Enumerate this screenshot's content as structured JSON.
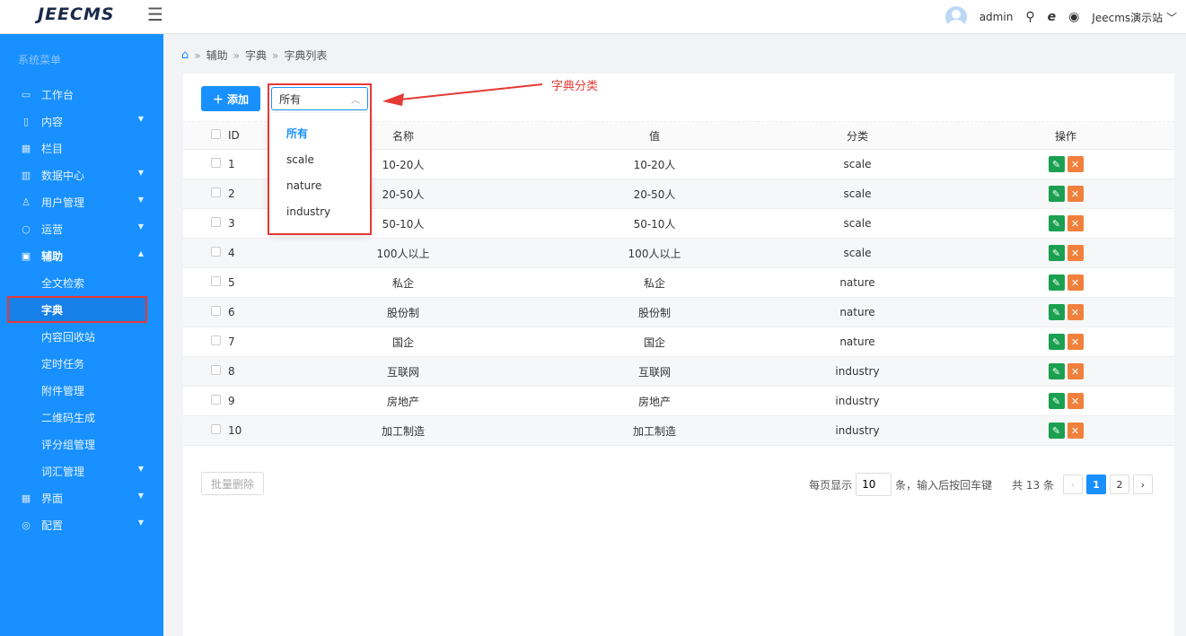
{
  "app": {
    "logo": "JEECMS",
    "menu_icon": "hamburger-icon"
  },
  "topbar": {
    "username": "admin",
    "site_name": "Jeecms演示站",
    "icons": [
      "user-icon",
      "ie-icon",
      "settings-icon"
    ]
  },
  "sidebar": {
    "title": "系统菜单",
    "items": [
      {
        "label": "工作台",
        "icon": "desktop-icon"
      },
      {
        "label": "内容",
        "icon": "document-icon",
        "arrow": "▼"
      },
      {
        "label": "栏目",
        "icon": "grid-icon"
      },
      {
        "label": "数据中心",
        "icon": "chart-icon",
        "arrow": "▼"
      },
      {
        "label": "用户管理",
        "icon": "user-icon",
        "arrow": "▼"
      },
      {
        "label": "运营",
        "icon": "circle-icon",
        "arrow": "▼"
      },
      {
        "label": "辅助",
        "icon": "briefcase-icon",
        "arrow": "▲"
      }
    ],
    "sub_items": [
      "全文检索",
      "字典",
      "内容回收站",
      "定时任务",
      "附件管理",
      "二维码生成",
      "评分组管理",
      "词汇管理"
    ],
    "sub_arrow": "▼",
    "bottom_items": [
      {
        "label": "界面",
        "icon": "layout-icon",
        "arrow": "▼"
      },
      {
        "label": "配置",
        "icon": "config-icon",
        "arrow": "▼"
      }
    ]
  },
  "breadcrumb": [
    "辅助",
    "字典",
    "字典列表"
  ],
  "toolbar": {
    "add_label": "添加",
    "select_value": "所有"
  },
  "annotation": "字典分类",
  "dropdown": {
    "options": [
      "所有",
      "scale",
      "nature",
      "industry"
    ]
  },
  "table": {
    "columns": [
      "ID",
      "名称",
      "值",
      "分类",
      "操作"
    ],
    "rows": [
      {
        "id": "1",
        "name": "10-20人",
        "value": "10-20人",
        "category": "scale"
      },
      {
        "id": "2",
        "name": "20-50人",
        "value": "20-50人",
        "category": "scale"
      },
      {
        "id": "3",
        "name": "50-10人",
        "value": "50-10人",
        "category": "scale"
      },
      {
        "id": "4",
        "name": "100人以上",
        "value": "100人以上",
        "category": "scale"
      },
      {
        "id": "5",
        "name": "私企",
        "value": "私企",
        "category": "nature"
      },
      {
        "id": "6",
        "name": "股份制",
        "value": "股份制",
        "category": "nature"
      },
      {
        "id": "7",
        "name": "国企",
        "value": "国企",
        "category": "nature"
      },
      {
        "id": "8",
        "name": "互联网",
        "value": "互联网",
        "category": "industry"
      },
      {
        "id": "9",
        "name": "房地产",
        "value": "房地产",
        "category": "industry"
      },
      {
        "id": "10",
        "name": "加工制造",
        "value": "加工制造",
        "category": "industry"
      }
    ]
  },
  "footer": {
    "batch_delete": "批量删除",
    "per_page_prefix": "每页显示",
    "per_page_value": "10",
    "per_page_suffix": "条，输入后按回车键",
    "total": "共 13 条",
    "pages": [
      "1",
      "2"
    ],
    "current_page": "1"
  },
  "colors": {
    "primary": "#1890ff",
    "edit": "#1aa050",
    "delete": "#f0803c",
    "annotation": "#e53935"
  }
}
